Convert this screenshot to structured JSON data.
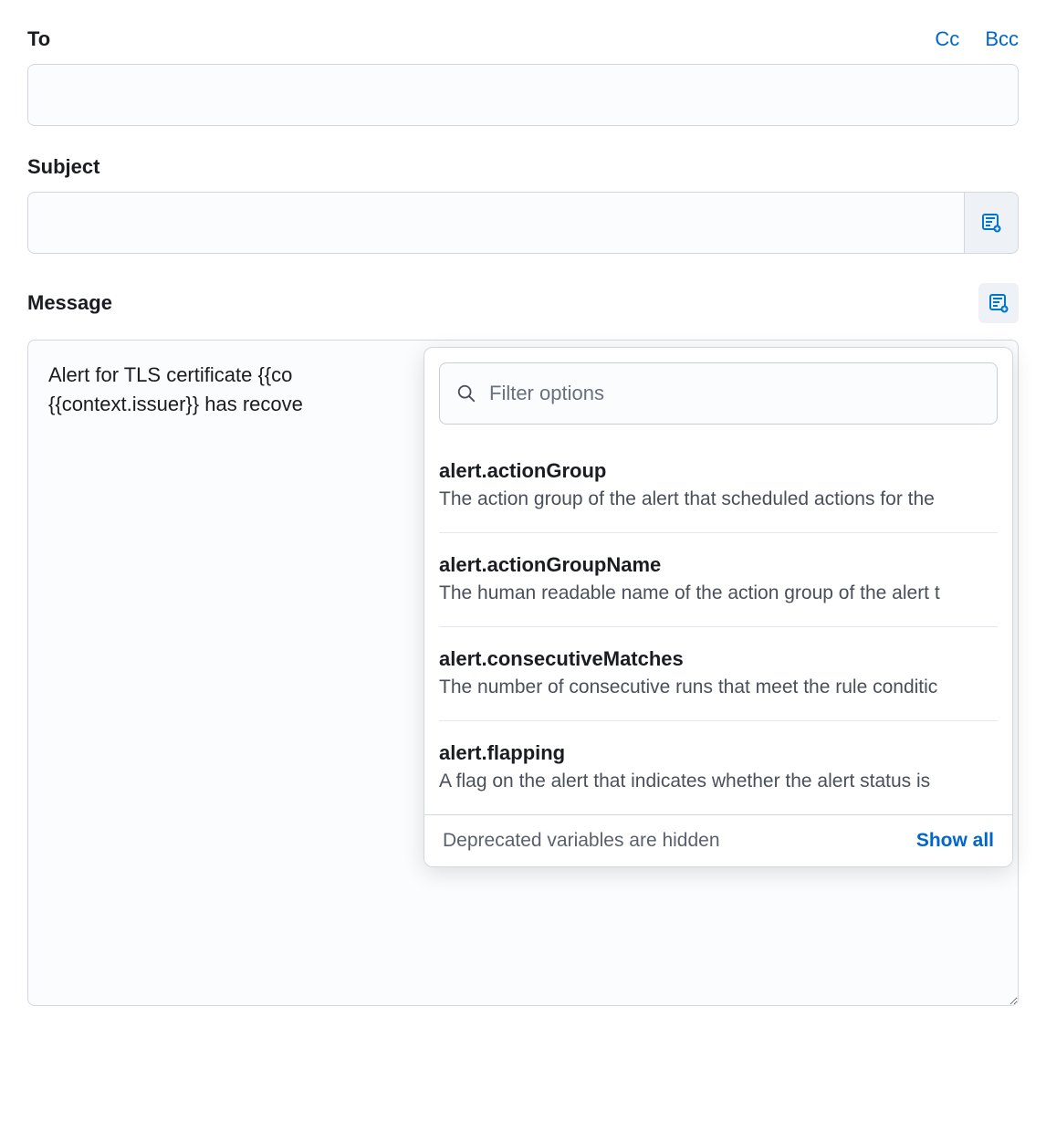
{
  "labels": {
    "to": "To",
    "subject": "Subject",
    "message": "Message"
  },
  "links": {
    "cc": "Cc",
    "bcc": "Bcc"
  },
  "values": {
    "to": "",
    "subject": "",
    "message_line1": "Alert for TLS certificate {{co",
    "message_line2": "{{context.issuer}} has recove"
  },
  "popover": {
    "filter_placeholder": "Filter options",
    "options": [
      {
        "name": "alert.actionGroup",
        "desc": "The action group of the alert that scheduled actions for the"
      },
      {
        "name": "alert.actionGroupName",
        "desc": "The human readable name of the action group of the alert t"
      },
      {
        "name": "alert.consecutiveMatches",
        "desc": "The number of consecutive runs that meet the rule conditic"
      },
      {
        "name": "alert.flapping",
        "desc": "A flag on the alert that indicates whether the alert status is"
      }
    ],
    "footer_text": "Deprecated variables are hidden",
    "show_all": "Show all"
  }
}
